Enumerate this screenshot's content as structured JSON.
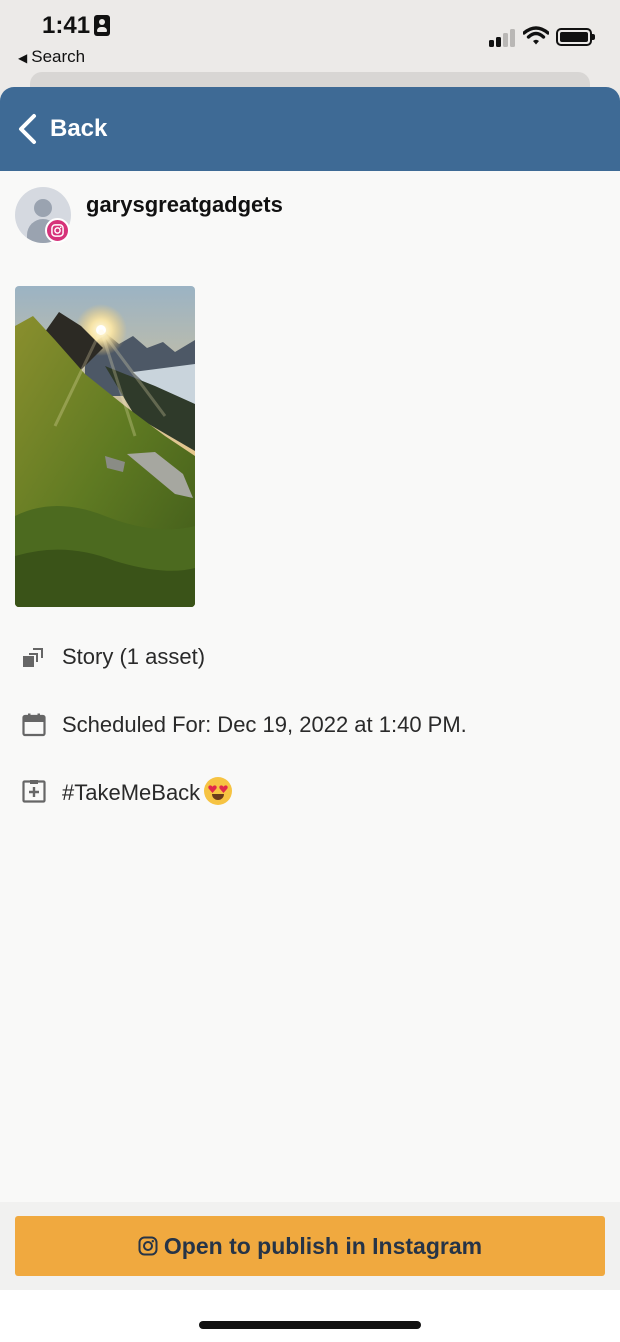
{
  "status_bar": {
    "time": "1:41",
    "back_to_app": "Search",
    "icons": [
      "id-card-icon",
      "cellular-signal-icon",
      "wifi-icon",
      "battery-icon"
    ]
  },
  "header": {
    "back_label": "Back",
    "background_color": "#3e6a95"
  },
  "profile": {
    "username": "garysgreatgadgets",
    "platform_badge": "instagram-icon"
  },
  "post": {
    "media_icon": "layers-icon",
    "media_label": "Story (1 asset)",
    "schedule_icon": "calendar-icon",
    "schedule_label": "Scheduled For: Dec 19, 2022 at 1:40 PM.",
    "caption_icon": "caption-icon",
    "caption_text": "#TakeMeBack",
    "caption_emoji": "heart-eyes-emoji"
  },
  "actions": {
    "publish_label": "Open to publish in Instagram",
    "publish_icon": "instagram-icon",
    "publish_color": "#f0a93f"
  }
}
